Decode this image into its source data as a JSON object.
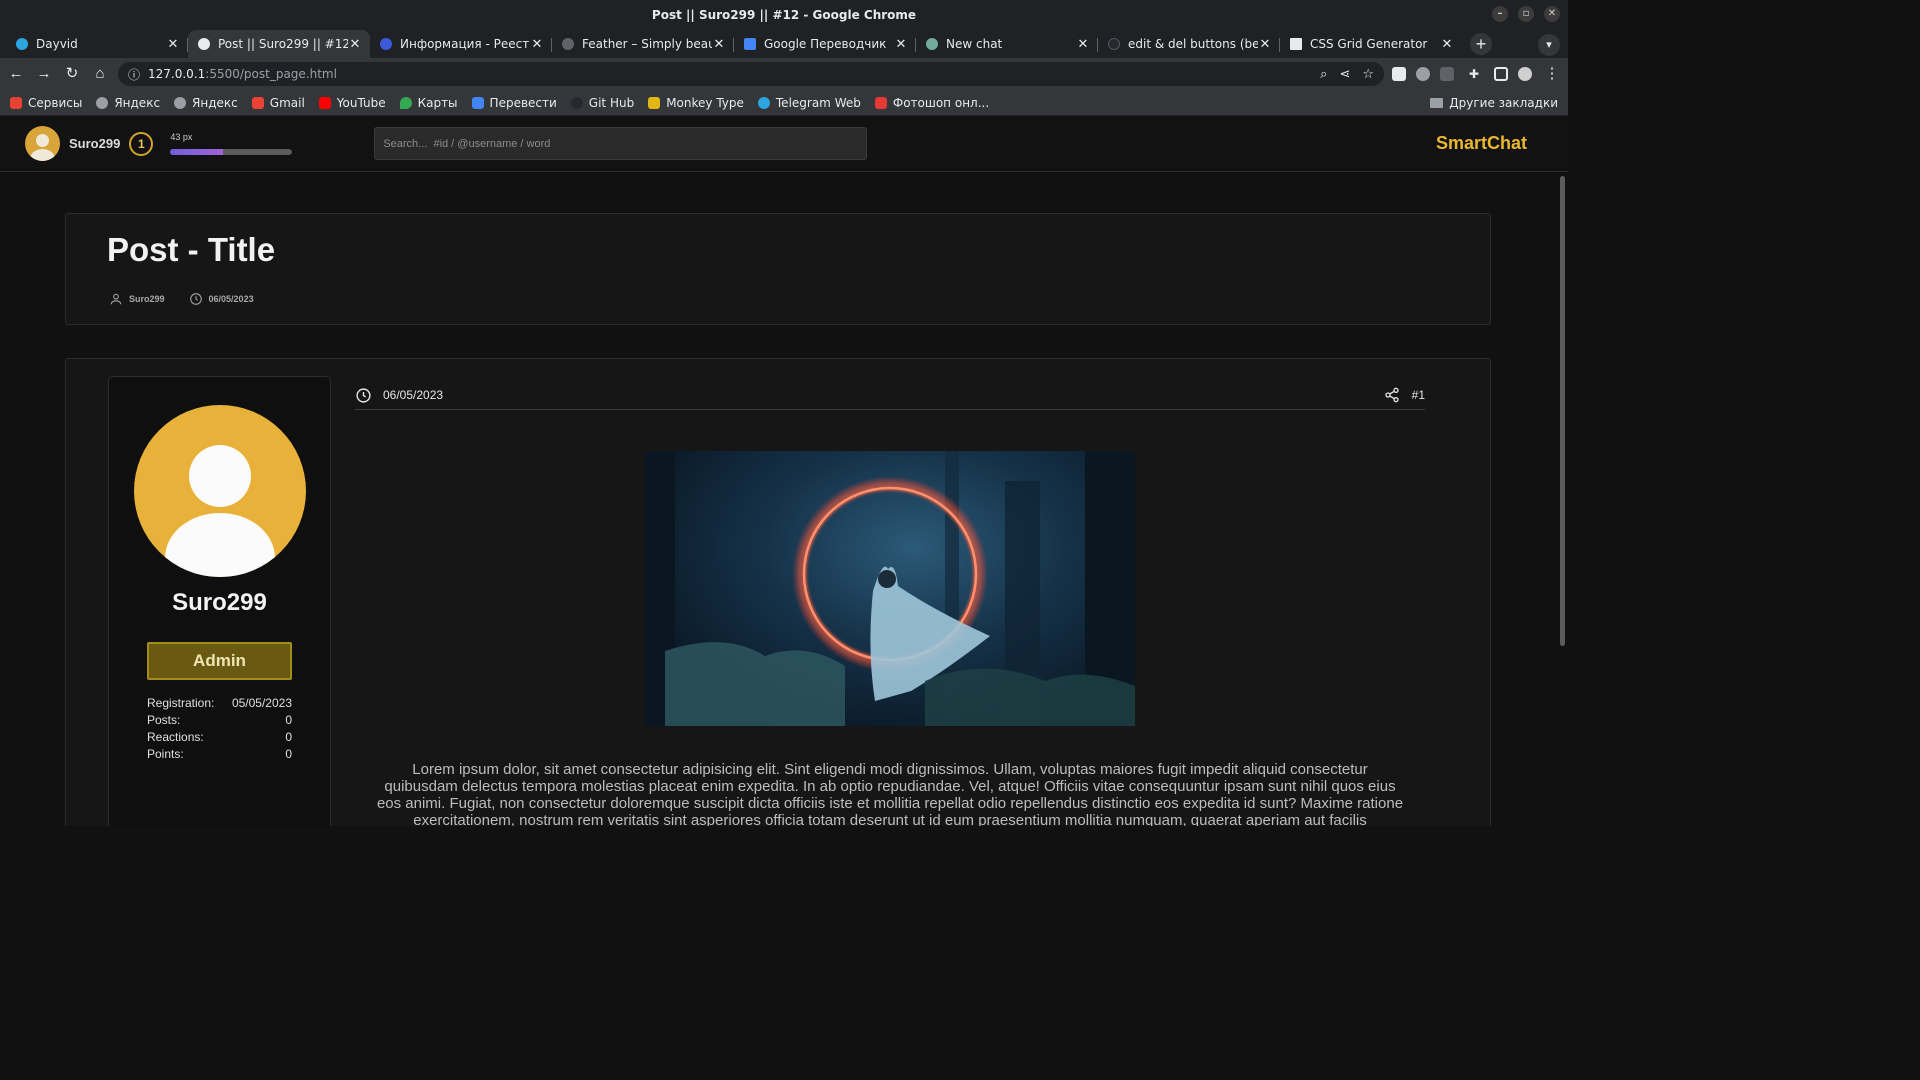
{
  "window": {
    "title": "Post || Suro299 || #12 - Google Chrome",
    "controls": [
      "–",
      "▫",
      "✕"
    ]
  },
  "tabs": [
    {
      "label": "Dayvid",
      "favicon_color": "#2ca5e0"
    },
    {
      "label": "Post || Suro299 || #12",
      "favicon_color": "#e8eaed",
      "active": true
    },
    {
      "label": "Информация - Реестр",
      "favicon_color": "#3b5bdb"
    },
    {
      "label": "Feather – Simply beauti",
      "favicon_color": "#5f6368"
    },
    {
      "label": "Google Переводчик",
      "favicon_color": "#4285f4"
    },
    {
      "label": "New chat",
      "favicon_color": "#74aa9c"
    },
    {
      "label": "edit & del buttons (beta",
      "favicon_color": "#24292e"
    },
    {
      "label": "CSS Grid Generator",
      "favicon_color": "#e8eaed"
    }
  ],
  "toolbar": {
    "url_host": "127.0.0.1",
    "url_rest": ":5500/post_page.html"
  },
  "bookmarks": [
    {
      "label": "Сервисы",
      "color": "#ea4335"
    },
    {
      "label": "Яндекс",
      "color": "#9aa0a6"
    },
    {
      "label": "Яндекс",
      "color": "#9aa0a6"
    },
    {
      "label": "Gmail",
      "color": "#ea4335"
    },
    {
      "label": "YouTube",
      "color": "#ff0000"
    },
    {
      "label": "Карты",
      "color": "#34a853"
    },
    {
      "label": "Перевести",
      "color": "#4285f4"
    },
    {
      "label": "Git Hub",
      "color": "#24292e"
    },
    {
      "label": "Monkey Type",
      "color": "#e2b714"
    },
    {
      "label": "Telegram Web",
      "color": "#2ca5e0"
    },
    {
      "label": "Фотошоп онл...",
      "color": "#e53935"
    }
  ],
  "bookmarks_other": "Другие закладки",
  "header": {
    "username": "Suro299",
    "level": "1",
    "xp_label": "43 px",
    "xp_progress": 0.43,
    "search_placeholder": "Search...  #id / @username / word",
    "brand": "SmartChat"
  },
  "post": {
    "title": "Post - Title",
    "author": "Suro299",
    "date": "06/05/2023"
  },
  "profile": {
    "name": "Suro299",
    "role": "Admin",
    "stats": [
      {
        "label": "Registration:",
        "value": "05/05/2023"
      },
      {
        "label": "Posts:",
        "value": "0"
      },
      {
        "label": "Reactions:",
        "value": "0"
      },
      {
        "label": "Points:",
        "value": "0"
      }
    ]
  },
  "content": {
    "date": "06/05/2023",
    "number": "#1",
    "image_alt": "hooded figure in a forest with glowing ring",
    "text": "Lorem ipsum dolor, sit amet consectetur adipisicing elit. Sint eligendi modi dignissimos. Ullam, voluptas maiores fugit impedit aliquid consectetur quibusdam delectus tempora molestias placeat enim expedita. In ab optio repudiandae. Vel, atque! Officiis vitae consequuntur ipsam sunt nihil quos eius eos animi. Fugiat, non consectetur doloremque suscipit dicta officiis iste et mollitia repellat odio repellendus distinctio eos expedita id sunt? Maxime ratione exercitationem, nostrum rem veritatis sint asperiores officia totam deserunt ut id eum praesentium mollitia numquam, quaerat aperiam aut facilis laboriosam nihil consectetur. Beatae porro odio quis quo exercitationem. Laudantium error quisquam earum fugit, fugiat nemo sunt labore vero ducimus! Quidem ea sequi obcaecati voluptatum laborum expedita, atque adipisci ab nobis. Magnam quia amet temporibus, maiores nihil possimus veritatis? Beatae est ab maiores voluptatibus molestiae eius earum. Quas eos harum vel voluptas magni ducimus voluptates. Impedit odit sint"
  },
  "colors": {
    "accent": "#e9b730",
    "role_bg": "#6a5a11",
    "avatar": "#e8b23a"
  }
}
